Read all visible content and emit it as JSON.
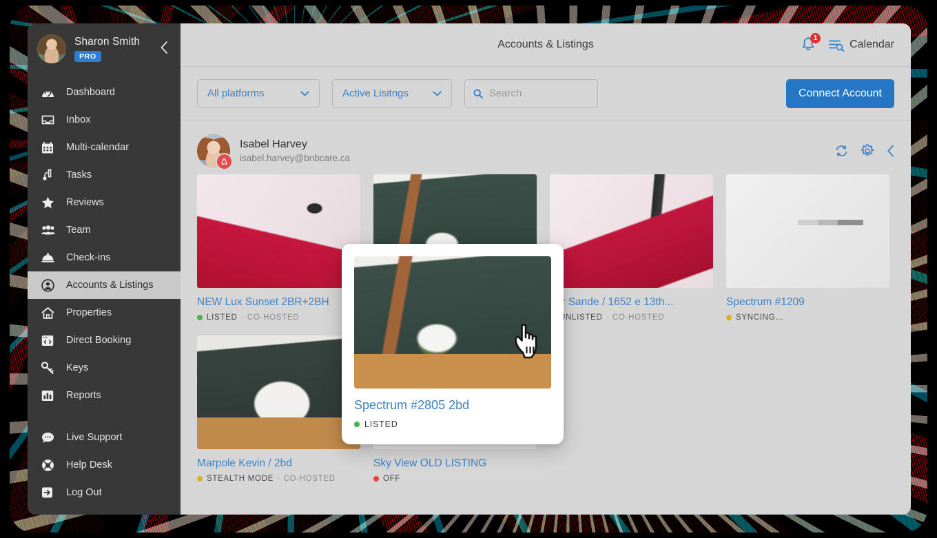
{
  "window": {
    "title": "Accounts & Listings"
  },
  "sidebar": {
    "user": {
      "name": "Sharon Smith",
      "badge": "PRO",
      "avatar_icon": "user-avatar-photo",
      "collapse_icon": "chevron-left-icon"
    },
    "items": [
      {
        "label": "Dashboard",
        "icon": "dashboard-gauge-icon",
        "active": false
      },
      {
        "label": "Inbox",
        "icon": "inbox-tray-icon",
        "active": false
      },
      {
        "label": "Multi-calendar",
        "icon": "calendar-grid-icon",
        "active": false
      },
      {
        "label": "Tasks",
        "icon": "vacuum-icon",
        "active": false
      },
      {
        "label": "Reviews",
        "icon": "star-icon",
        "active": false
      },
      {
        "label": "Team",
        "icon": "people-group-icon",
        "active": false
      },
      {
        "label": "Check-ins",
        "icon": "service-bell-icon",
        "active": false
      },
      {
        "label": "Accounts & Listings",
        "icon": "user-circle-icon",
        "active": true
      },
      {
        "label": "Properties",
        "icon": "home-icon",
        "active": false
      },
      {
        "label": "Direct Booking",
        "icon": "code-window-icon",
        "active": false
      },
      {
        "label": "Keys",
        "icon": "key-icon",
        "active": false
      },
      {
        "label": "Reports",
        "icon": "bar-chart-icon",
        "active": false
      }
    ],
    "bottom_items": [
      {
        "label": "Live Support",
        "icon": "chat-bubble-icon"
      },
      {
        "label": "Help Desk",
        "icon": "lifebuoy-icon"
      },
      {
        "label": "Log Out",
        "icon": "logout-arrow-icon"
      }
    ]
  },
  "topbar": {
    "title": "Accounts & Listings",
    "notifications": {
      "icon": "bell-icon",
      "count": "1",
      "badge_color": "#e03030"
    },
    "calendar": {
      "icon": "calendar-search-icon",
      "label": "Calendar"
    }
  },
  "filterbar": {
    "platform_select": {
      "value": "All platforms",
      "chevron_icon": "chevron-down-icon"
    },
    "listings_select": {
      "value": "Active Lisitngs",
      "chevron_icon": "chevron-down-icon"
    },
    "search": {
      "icon": "search-icon",
      "value": "",
      "placeholder": "Search"
    },
    "connect_button": {
      "label": "Connect Account",
      "color": "#2577c5"
    }
  },
  "account": {
    "name": "Isabel Harvey",
    "email": "isabel.harvey@bnbcare.ca",
    "avatar_icon": "account-avatar-photo",
    "platform_badge_icon": "airbnb-icon",
    "actions": [
      {
        "icon": "refresh-sync-icon",
        "name": "refresh-account"
      },
      {
        "icon": "gear-icon",
        "name": "account-settings"
      },
      {
        "icon": "chevron-left-icon",
        "name": "collapse-account"
      }
    ]
  },
  "listings": [
    {
      "title": "NEW Lux Sunset 2BR+2BH",
      "status": "LISTED",
      "status_color": "#4caf50",
      "co_hosted": "· CO-HOSTED",
      "image": "img-stairs-pink"
    },
    {
      "title": "Spectrum #2805 2bd",
      "status": "LISTED",
      "status_color": "#4caf50",
      "co_hosted": "",
      "image": "img-green-bath"
    },
    {
      "title": "der Sande / 1652 e 13th...",
      "status": "UNLISTED",
      "status_color": "#4caf50",
      "co_hosted": "· CO-HOSTED",
      "image": "img-stairs-pink2"
    },
    {
      "title": "Spectrum #1209",
      "status": "SYNCING...",
      "status_color": "#d9b125",
      "co_hosted": "",
      "image": "img-bath-faded"
    },
    {
      "title": "Marpole Kevin / 2bd",
      "status": "STEALTH MODE",
      "status_color": "#d9b125",
      "co_hosted": "· CO-HOSTED",
      "image": "img-bedroom-green"
    },
    {
      "title": "Sky View OLD LISTING",
      "status": "OFF",
      "status_color": "#e8413c",
      "co_hosted": "",
      "image": "img-stairs-faded"
    }
  ],
  "popup": {
    "title": "Spectrum #2805 2bd",
    "status": "LISTED",
    "status_color": "#4caf50",
    "image": "img-green-bath"
  },
  "cursor": {
    "icon": "pointing-hand-cursor"
  }
}
